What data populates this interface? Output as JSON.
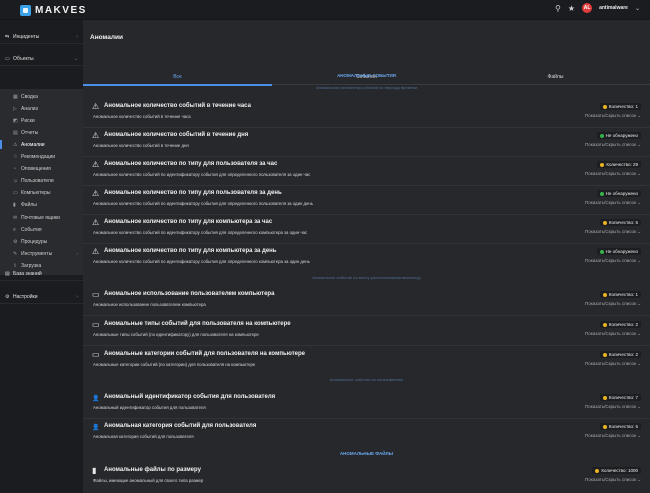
{
  "app": {
    "brand": "MAKVES",
    "user": "antimalware",
    "user_initials": "AL"
  },
  "colors": {
    "accent": "#4b8ee8",
    "warning": "#e9b320",
    "ok": "#36b24a",
    "avatar": "#e03c3c"
  },
  "sidebar": {
    "sections": [
      {
        "label": "Инциденты",
        "icon": "incidents-icon",
        "symbol": "⇆"
      },
      {
        "label": "Объекты",
        "icon": "objects-icon",
        "symbol": "▭"
      },
      {
        "label": "База знаний",
        "icon": "knowledge-base-icon",
        "symbol": "▤"
      },
      {
        "label": "Настройки",
        "icon": "settings-icon",
        "symbol": "⚙"
      }
    ],
    "items": [
      {
        "label": "Сводка",
        "icon": "summary-icon",
        "symbol": "▦"
      },
      {
        "label": "Анализ",
        "icon": "analysis-icon",
        "symbol": "▷"
      },
      {
        "label": "Риски",
        "icon": "risks-icon",
        "symbol": "◩"
      },
      {
        "label": "Отчеты",
        "icon": "reports-icon",
        "symbol": "▤"
      },
      {
        "label": "Аномалии",
        "icon": "anomalies-icon",
        "symbol": "⚠"
      },
      {
        "label": "Рекомендации",
        "icon": "recommendations-icon",
        "symbol": "☆"
      },
      {
        "label": "Оповещения",
        "icon": "notifications-icon",
        "symbol": "◔"
      },
      {
        "label": "Пользователи",
        "icon": "users-icon",
        "symbol": "☺"
      },
      {
        "label": "Компьютеры",
        "icon": "computers-icon",
        "symbol": "▭"
      },
      {
        "label": "Файлы",
        "icon": "files-icon",
        "symbol": "▮"
      },
      {
        "label": "Почтовые ящики",
        "icon": "mailboxes-icon",
        "symbol": "✉"
      },
      {
        "label": "События",
        "icon": "events-icon",
        "symbol": "≡"
      },
      {
        "label": "Процедуры",
        "icon": "procedures-icon",
        "symbol": "⚙"
      },
      {
        "label": "Инструменты",
        "icon": "tools-icon",
        "symbol": "✎"
      },
      {
        "label": "Загрузка",
        "icon": "upload-icon",
        "symbol": "⇪"
      }
    ]
  },
  "main": {
    "title": "Аномалии",
    "tabs": [
      "Все",
      "События",
      "Файлы"
    ],
    "show_list_label": "Показать/Скрыть список",
    "sections": [
      {
        "header": "АНОМАЛЬНЫЕ СОБЫТИЯ",
        "style": "head"
      },
      {
        "header": "Аномальное количество событий по периоду времени",
        "style": "faint"
      },
      {
        "header": "Аномальное событие по месту расположения/компьютеру",
        "style": "faint"
      },
      {
        "header": "Аномальные события по пользователю",
        "style": "faint"
      },
      {
        "header": "АНОМАЛЬНЫЕ ФАЙЛЫ",
        "style": "head"
      }
    ],
    "rows": [
      {
        "icon": "warning-icon",
        "symbol": "⚠",
        "title": "Аномальное количество событий в течение часа",
        "desc": "Аномальное количество событий в течение часа",
        "status": "Количество: 1",
        "status_type": "warning"
      },
      {
        "icon": "warning-icon",
        "symbol": "⚠",
        "title": "Аномальное количество событий в течение дня",
        "desc": "Аномальное количество событий в течение дня",
        "status": "Не обнаружено",
        "status_type": "ok"
      },
      {
        "icon": "warning-icon",
        "symbol": "⚠",
        "title": "Аномальное количество по типу для пользователя за час",
        "desc": "Аномальное количество событий по идентификатору события для определенного пользователя за один час",
        "status": "Количество: 29",
        "status_type": "warning"
      },
      {
        "icon": "warning-icon",
        "symbol": "⚠",
        "title": "Аномальное количество по типу для пользователя за день",
        "desc": "Аномальное количество событий по идентификатору события для определенного пользователя за один день",
        "status": "Не обнаружено",
        "status_type": "ok"
      },
      {
        "icon": "warning-icon",
        "symbol": "⚠",
        "title": "Аномальное количество по типу для компьютера за час",
        "desc": "Аномальное количество событий по идентификатору события для определенного компьютера за один час",
        "status": "Количество: 5",
        "status_type": "warning"
      },
      {
        "icon": "warning-icon",
        "symbol": "⚠",
        "title": "Аномальное количество по типу для компьютера за день",
        "desc": "Аномальное количество событий по идентификатору события для определенного компьютера за один день",
        "status": "Не обнаружено",
        "status_type": "ok"
      },
      {
        "icon": "laptop-icon",
        "symbol": "▭",
        "title": "Аномальное использование пользователем компьютера",
        "desc": "Аномальное использование пользователем компьютера",
        "status": "Количество: 1",
        "status_type": "warning"
      },
      {
        "icon": "laptop-icon",
        "symbol": "▭",
        "title": "Аномальные типы событий для пользователя на компьютере",
        "desc": "Аномальные типы событий (по идентификатору) для пользователя на компьютере",
        "status": "Количество: 2",
        "status_type": "warning"
      },
      {
        "icon": "laptop-icon",
        "symbol": "▭",
        "title": "Аномальные категории событий для пользователя на компьютере",
        "desc": "Аномальные категории событий (по категории) для пользователя на компьютере",
        "status": "Количество: 2",
        "status_type": "warning"
      },
      {
        "icon": "user-icon",
        "symbol": "👤",
        "title": "Аномальный идентификатор события для пользователя",
        "desc": "Аномальный идентификатор события для пользователя",
        "status": "Количество: 7",
        "status_type": "warning"
      },
      {
        "icon": "user-icon",
        "symbol": "👤",
        "title": "Аномальная категория событий для пользователя",
        "desc": "Аномальная категория событий для пользователя",
        "status": "Количество: 5",
        "status_type": "warning"
      },
      {
        "icon": "file-icon",
        "symbol": "▮",
        "title": "Аномальные файлы по размеру",
        "desc": "Файлы, имеющие аномальный для своего типа размер",
        "status": "Количество: 1000",
        "status_type": "warning"
      }
    ]
  }
}
